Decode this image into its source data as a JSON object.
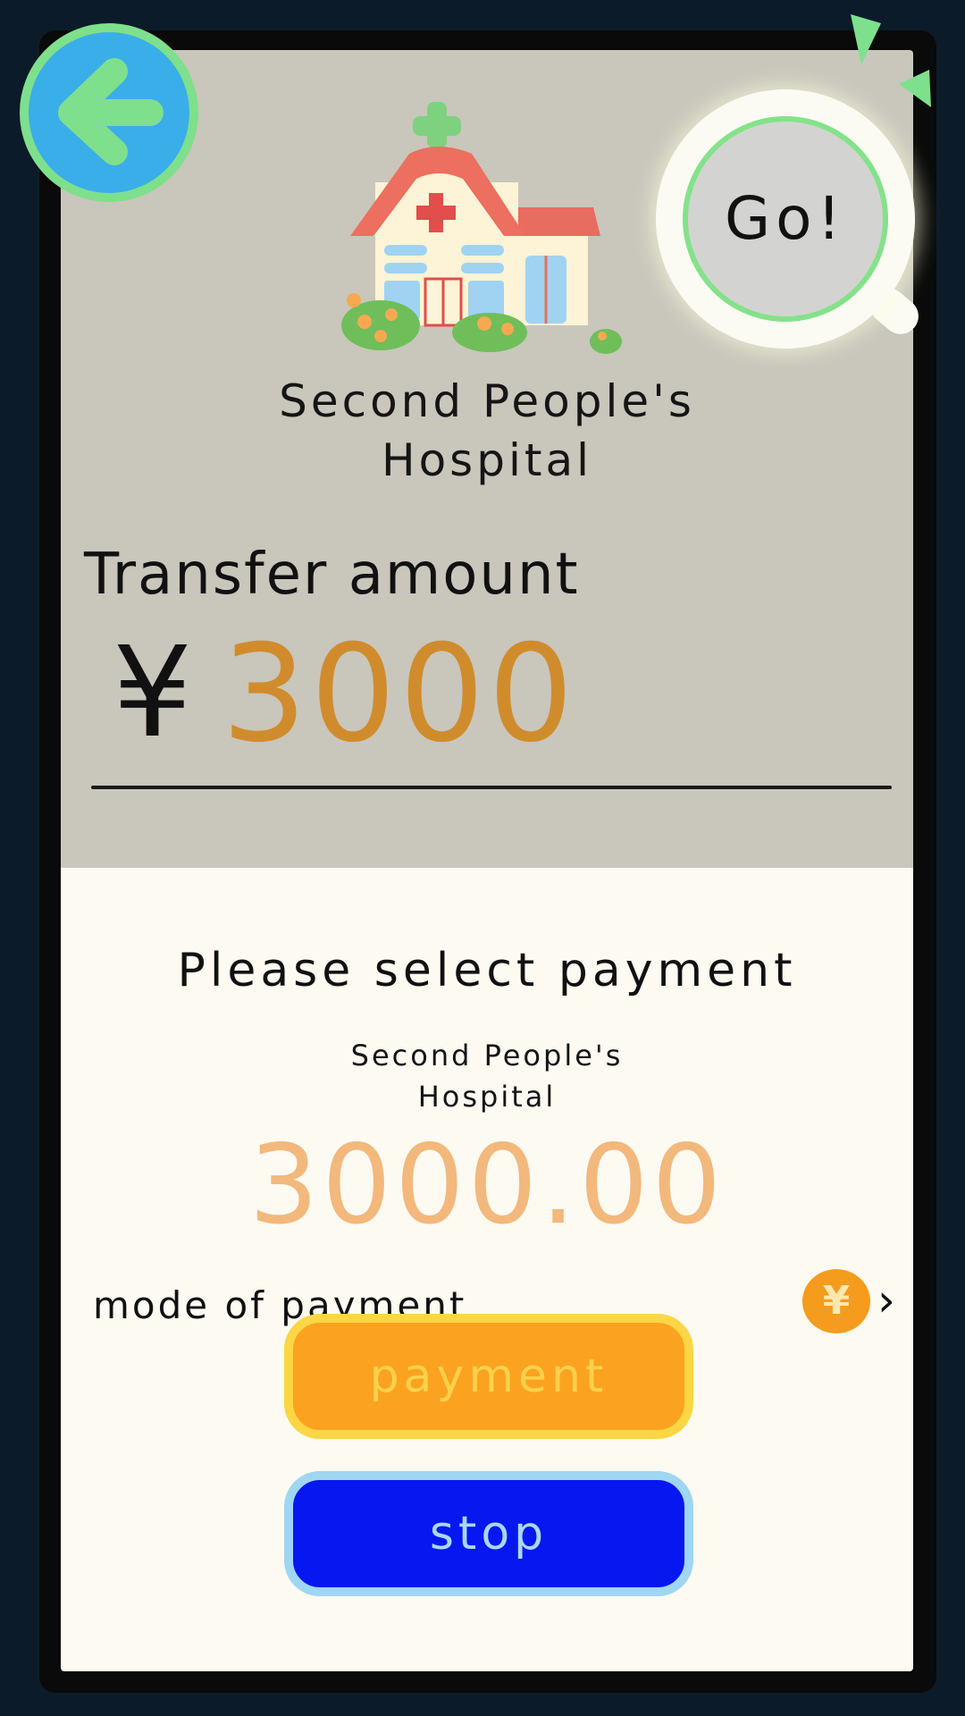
{
  "header": {
    "back_icon": "arrow-left-icon",
    "go_label": "Go!",
    "go_icon": "magnifier-icon"
  },
  "merchant": {
    "name": "Second People's\nHospital",
    "illustration": "hospital-illustration"
  },
  "transfer": {
    "label": "Transfer amount",
    "currency_symbol": "¥",
    "amount": "3000"
  },
  "payment_sheet": {
    "title": "Please select payment",
    "merchant_name": "Second People's\nHospital",
    "amount": "3000.00",
    "mode_label": "mode of payment",
    "mode_icon": "yuan-coin-icon",
    "mode_coin_glyph": "¥",
    "chevron": "›",
    "payment_button": "payment",
    "stop_button": "stop"
  },
  "colors": {
    "background": "#0c1b29",
    "top_panel": "#c9c6bc",
    "bottom_panel": "#fdfaf2",
    "amount_accent": "#d08c2c",
    "sheet_amount": "#f3b87c",
    "payment_button": "#fba320",
    "stop_button": "#0717f0",
    "back_button": "#3aaee8",
    "highlight_green": "#7ee08c"
  }
}
